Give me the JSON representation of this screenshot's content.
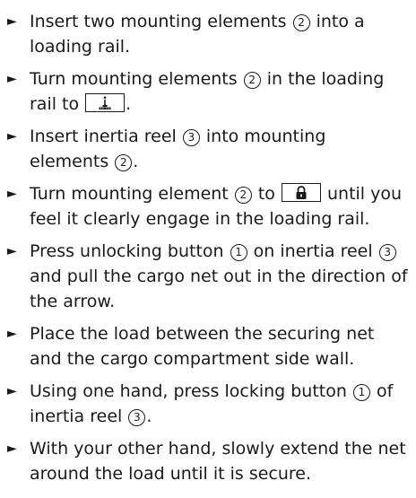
{
  "bullet": "►",
  "steps": [
    {
      "parts": [
        "Insert two mounting elements ",
        "2",
        " into a loading rail."
      ]
    },
    {
      "parts": [
        "Turn mounting elements ",
        "2",
        " in the loading rail to ",
        "[unlock-symbol]",
        "."
      ]
    },
    {
      "parts": [
        "Insert inertia reel ",
        "3",
        " into mounting elements ",
        "2",
        "."
      ]
    },
    {
      "parts": [
        "Turn mounting element ",
        "2",
        " to ",
        "[lock-symbol]",
        " until you feel it clearly engage in the loading rail."
      ]
    },
    {
      "parts": [
        "Press unlocking button ",
        "1",
        " on inertia reel ",
        "3",
        " and pull the cargo net out in the direction of the arrow."
      ]
    },
    {
      "parts": [
        "Place the load between the securing net and the cargo compartment side wall."
      ]
    },
    {
      "parts": [
        "Using one hand, press locking button ",
        "1",
        " of inertia reel ",
        "3",
        "."
      ]
    },
    {
      "parts": [
        "With your other hand, slowly extend the net around the load until it is secure."
      ]
    }
  ],
  "icons": {
    "unlock": "unlock-symbol-icon",
    "lock": "padlock-icon"
  }
}
